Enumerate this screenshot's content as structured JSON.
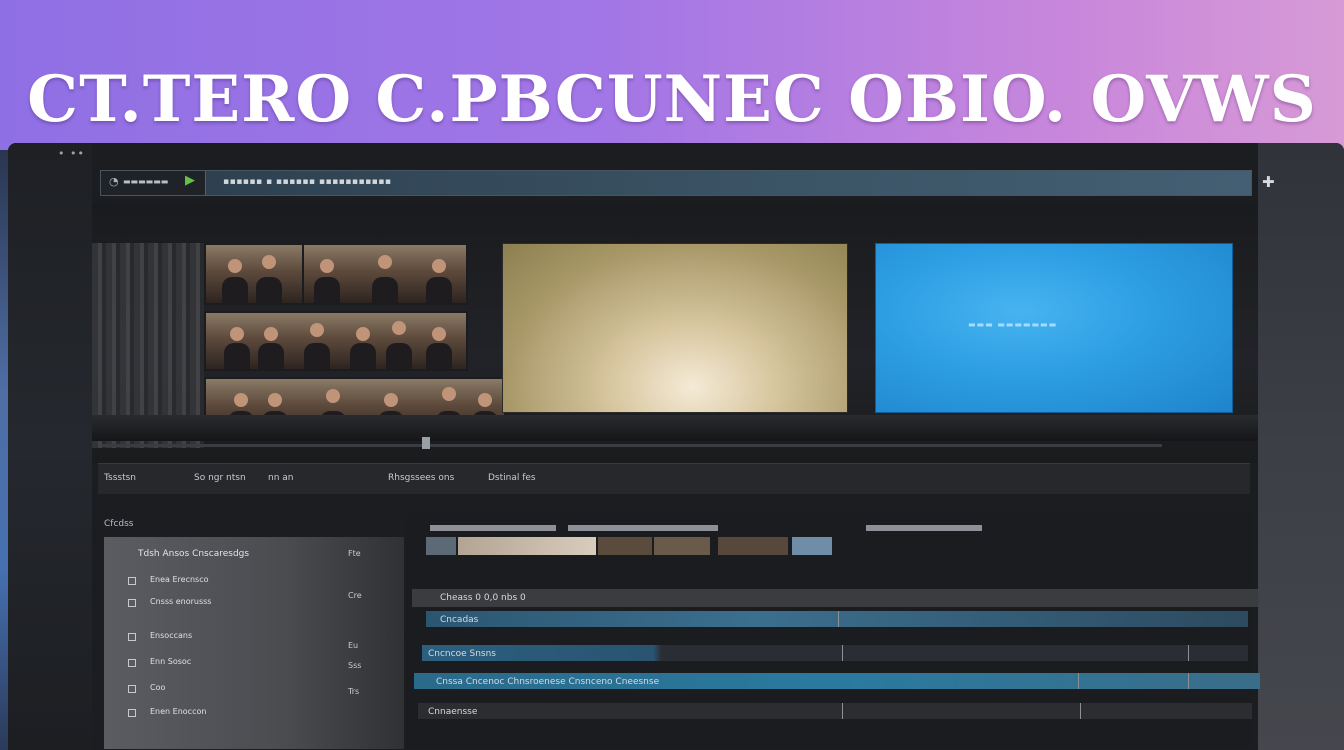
{
  "banner": {
    "title": "CT.TERO C.PBCUNEC OBIO. OVWS"
  },
  "window": {
    "menu_dots": "• ••",
    "toolbar": {
      "brand": "▬▬▬▬▬▬",
      "path": "▪▪▪▪▪▪ ▪ ▪▪▪▪▪▪ ▪▪▪▪▪▪▪▪▪▪▪"
    },
    "preview": {
      "blue_text": "▬▬▬  ▬▬▬▬▬▬▬"
    },
    "tabs": [
      {
        "label": "Tssstsn"
      },
      {
        "label": "So ngr ntsn"
      },
      {
        "label": "nn an"
      },
      {
        "label": "Rhsgssees ons"
      },
      {
        "label": "Dstinal fes"
      }
    ],
    "media_panel": {
      "head": "Cfcdss ",
      "title": "Tdsh Ansos Cnscaresdgs",
      "rows": [
        {
          "label": "Enea Erecnsco"
        },
        {
          "label": "Cnsss enorusss"
        },
        {
          "label": "Ensoccans"
        },
        {
          "label": "Enn Sosoc"
        },
        {
          "label": "Coo"
        },
        {
          "label": "Enen Enoccon"
        }
      ],
      "right": [
        "Fte",
        "Cre",
        "Eu",
        "Sss",
        "Trs"
      ]
    },
    "timeline": {
      "tracks": [
        {
          "label": "Cheass   0        0,0      nbs   0"
        },
        {
          "label": "Cncadas"
        },
        {
          "label": "Cncncoe      Snsns"
        },
        {
          "label": "Cnssa    Cncenoc Chnsroenese            Cnsnceno Cneesnse"
        },
        {
          "label": "Cnnaensse"
        }
      ]
    }
  },
  "colors": {
    "banner_start": "#8f70e4",
    "banner_end": "#d79ad6",
    "accent_blue": "#2d9ee3",
    "timeline_blue": "#2e5f7c"
  },
  "icons": [
    "power-icon",
    "play-icon",
    "puzzle-icon"
  ]
}
